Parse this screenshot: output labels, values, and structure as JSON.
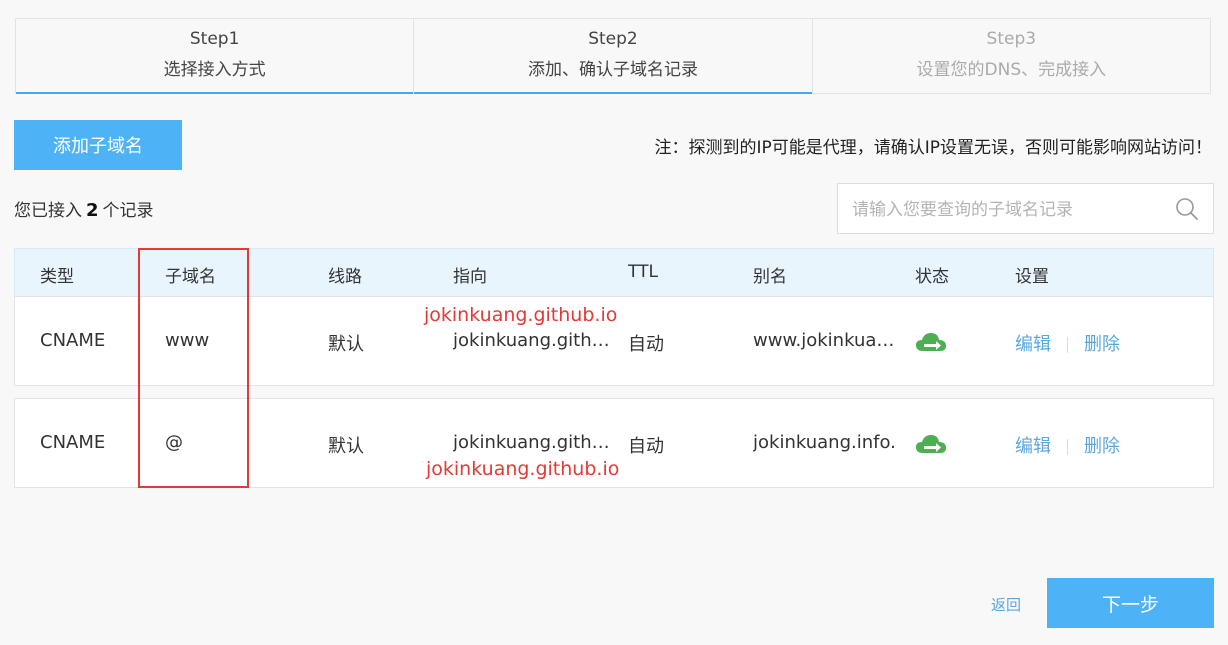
{
  "steps": [
    {
      "title": "Step1",
      "desc": "选择接入方式"
    },
    {
      "title": "Step2",
      "desc": "添加、确认子域名记录"
    },
    {
      "title": "Step3",
      "desc": "设置您的DNS、完成接入"
    }
  ],
  "toolbar": {
    "add_label": "添加子域名",
    "notice": "注：探测到的IP可能是代理，请确认IP设置无误，否则可能影响网站访问！"
  },
  "summary": {
    "prefix": "您已接入",
    "count": "2",
    "suffix": "个记录"
  },
  "search": {
    "placeholder": "请输入您要查询的子域名记录",
    "icon": "search-icon"
  },
  "table": {
    "headers": [
      "类型",
      "子域名",
      "线路",
      "指向",
      "TTL",
      "别名",
      "状态",
      "设置"
    ],
    "rows": [
      {
        "type": "CNAME",
        "subdomain": "www",
        "line": "默认",
        "point": "jokinkuang.github.io",
        "ttl": "自动",
        "alias": "www.jokinkuang.info",
        "status_icon": "cloud-arrow-icon",
        "edit": "编辑",
        "delete": "删除"
      },
      {
        "type": "CNAME",
        "subdomain": "@",
        "line": "默认",
        "point": "jokinkuang.github.io",
        "ttl": "自动",
        "alias": "jokinkuang.info.",
        "status_icon": "cloud-arrow-icon",
        "edit": "编辑",
        "delete": "删除"
      }
    ]
  },
  "annotations": {
    "note1": "jokinkuang.github.io",
    "note2": "jokinkuang.github.io",
    "color": "#e53935"
  },
  "footer": {
    "back_label": "返回",
    "next_label": "下一步"
  },
  "colors": {
    "accent": "#4db3f6",
    "link": "#5aa7de",
    "status_green": "#4caf50"
  }
}
